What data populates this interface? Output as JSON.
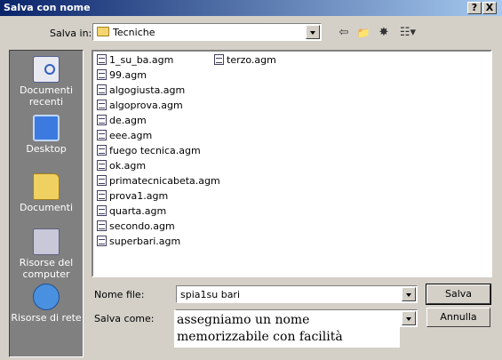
{
  "window": {
    "title": "Salva con nome",
    "help_glyph": "?",
    "close_glyph": "X"
  },
  "toolbar": {
    "save_in_label": "Salva in:",
    "current_folder": "Tecniche",
    "icons": [
      "back-icon",
      "up-folder-icon",
      "new-folder-icon",
      "view-menu-icon"
    ]
  },
  "places": [
    {
      "label": "Documenti recenti",
      "icon": "recent-documents-icon"
    },
    {
      "label": "Desktop",
      "icon": "desktop-icon"
    },
    {
      "label": "Documenti",
      "icon": "documents-icon"
    },
    {
      "label": "Risorse del computer",
      "icon": "my-computer-icon"
    },
    {
      "label": "Risorse di rete",
      "icon": "network-icon"
    }
  ],
  "files": {
    "column1": [
      "1_su_ba.agm",
      "99.agm",
      "algogiusta.agm",
      "algoprova.agm",
      "de.agm",
      "eee.agm",
      "fuego tecnica.agm",
      "ok.agm",
      "primatecnicabeta.agm",
      "prova1.agm",
      "quarta.agm",
      "secondo.agm",
      "superbari.agm"
    ],
    "column2": [
      "terzo.agm"
    ]
  },
  "form": {
    "file_name_label": "Nome file:",
    "file_name_value": "spia1su bari",
    "save_as_label": "Salva come:",
    "save_as_value": ""
  },
  "buttons": {
    "save": "Salva",
    "cancel": "Annulla"
  },
  "annotation": {
    "line1": "assegniamo un nome",
    "line2": "memorizzabile con facilità"
  }
}
